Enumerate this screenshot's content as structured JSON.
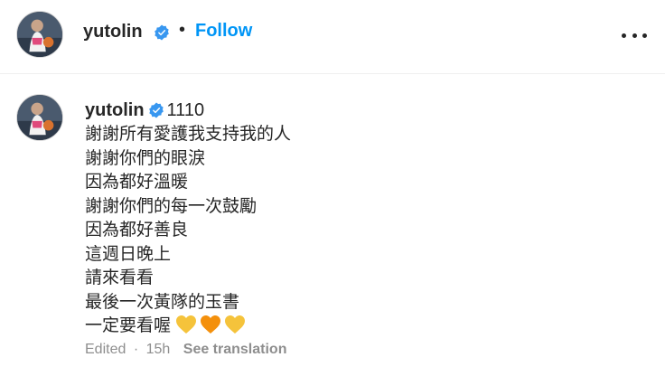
{
  "header": {
    "username": "yutolin",
    "separator": "•",
    "follow_label": "Follow",
    "more_icon": "more-horizontal-icon"
  },
  "caption": {
    "username": "yutolin",
    "prefix": "1110",
    "lines": [
      "謝謝所有愛護我支持我的人",
      "謝謝你們的眼淚",
      "因為都好溫暖",
      "謝謝你們的每一次鼓勵",
      "因為都好善良",
      "這週日晚上",
      "請來看看",
      "最後一次黃隊的玉書",
      "一定要看喔"
    ],
    "hearts": [
      {
        "icon": "yellow-heart-icon",
        "color": "#f5c33b"
      },
      {
        "icon": "orange-heart-icon",
        "color": "#f4900c"
      },
      {
        "icon": "yellow-heart-icon",
        "color": "#f5c33b"
      }
    ]
  },
  "meta": {
    "edited": "Edited",
    "dot": "·",
    "time": "15h",
    "see_translation": "See translation"
  },
  "colors": {
    "accent": "#0095f6",
    "verified": "#3897f0",
    "muted": "#8e8e8e"
  }
}
